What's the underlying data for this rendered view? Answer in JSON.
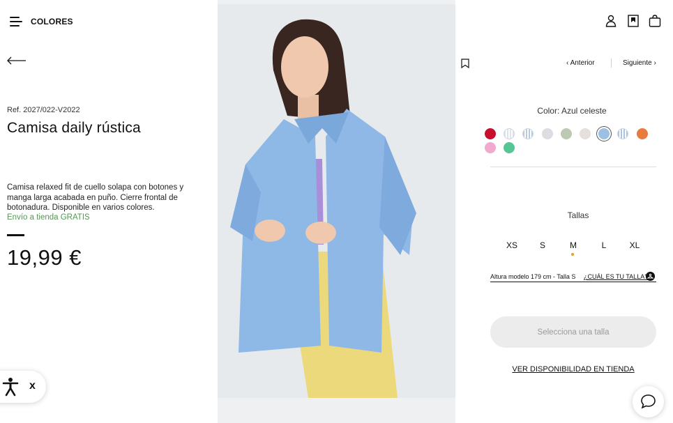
{
  "header": {
    "menu_icon": "hamburger-menu-icon",
    "brand_label": "COLORES",
    "user_icon": "user-icon",
    "wishlist_icon": "bookmark-icon",
    "bag_icon": "shopping-bag-icon"
  },
  "back_icon": "back-arrow-icon",
  "product": {
    "ref": "Ref. 2027/022-V2022",
    "title": "Camisa daily rústica",
    "description": "Camisa relaxed fit de cuello solapa con botones y manga larga acabada en puño. Cierre frontal de botonadura. Disponible en varios colores.",
    "shipping": "Envío a tienda GRATIS",
    "price": "19,99 €"
  },
  "navigation": {
    "prev_label": "Anterior",
    "next_label": "Siguiente"
  },
  "colors": {
    "label": "Color: Azul celeste",
    "swatches": [
      {
        "name": "red",
        "color": "#c8102e"
      },
      {
        "name": "white-stripe",
        "color": "#dfe3ea"
      },
      {
        "name": "blue-stripe",
        "color": "#b7c9dc"
      },
      {
        "name": "light-grey",
        "color": "#dcdde2"
      },
      {
        "name": "sage",
        "color": "#bccab3"
      },
      {
        "name": "beige",
        "color": "#e6dfdb"
      },
      {
        "name": "sky-blue",
        "color": "#9dbfe1",
        "selected": true
      },
      {
        "name": "blue-white-stripe",
        "color": "#a9c4e2"
      },
      {
        "name": "orange",
        "color": "#ea7b3e"
      },
      {
        "name": "pink",
        "color": "#f2a9cf"
      },
      {
        "name": "mint",
        "color": "#56c695"
      }
    ]
  },
  "sizes": {
    "label": "Tallas",
    "options": [
      "XS",
      "S",
      "M",
      "L",
      "XL"
    ]
  },
  "model_info": "Altura modelo 179 cm - Talla S",
  "size_guide_label": "¿CUÁL ES TU TALLA?",
  "select_size_button": "Selecciona una talla",
  "store_availability_link": "VER DISPONIBILIDAD EN TIENDA",
  "accessibility": {
    "icon": "accessibility-icon",
    "close_label": "x"
  },
  "chat_icon": "chat-bubble-icon"
}
